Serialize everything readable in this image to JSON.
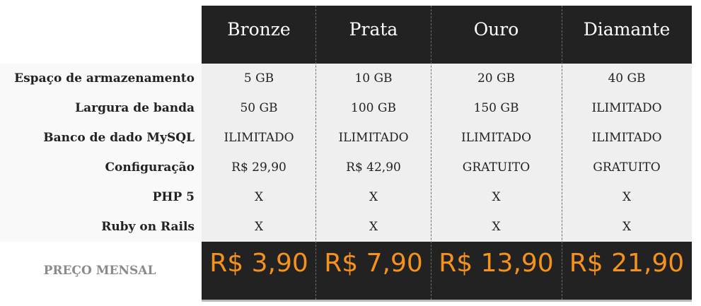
{
  "features": [
    "Espaço de armazenamento",
    "Largura de banda",
    "Banco de dado MySQL",
    "Configuração",
    "PHP 5",
    "Ruby on Rails"
  ],
  "price_label": "PREÇO MENSAL",
  "plans": [
    {
      "name": "Bronze",
      "values": [
        "5 GB",
        "50 GB",
        "ILIMITADO",
        "R$ 29,90",
        "X",
        "X"
      ],
      "price": "R$ 3,90"
    },
    {
      "name": "Prata",
      "values": [
        "10 GB",
        "100 GB",
        "ILIMITADO",
        "R$ 42,90",
        "X",
        "X"
      ],
      "price": "R$ 7,90"
    },
    {
      "name": "Ouro",
      "values": [
        "20 GB",
        "150 GB",
        "ILIMITADO",
        "GRATUITO",
        "X",
        "X"
      ],
      "price": "R$ 13,90"
    },
    {
      "name": "Diamante",
      "values": [
        "40 GB",
        "ILIMITADO",
        "ILIMITADO",
        "GRATUITO",
        "X",
        "X"
      ],
      "price": "R$ 21,90"
    }
  ],
  "colors": {
    "header_bg": "#222222",
    "price_accent": "#f5921e",
    "body_bg": "#efefef"
  }
}
